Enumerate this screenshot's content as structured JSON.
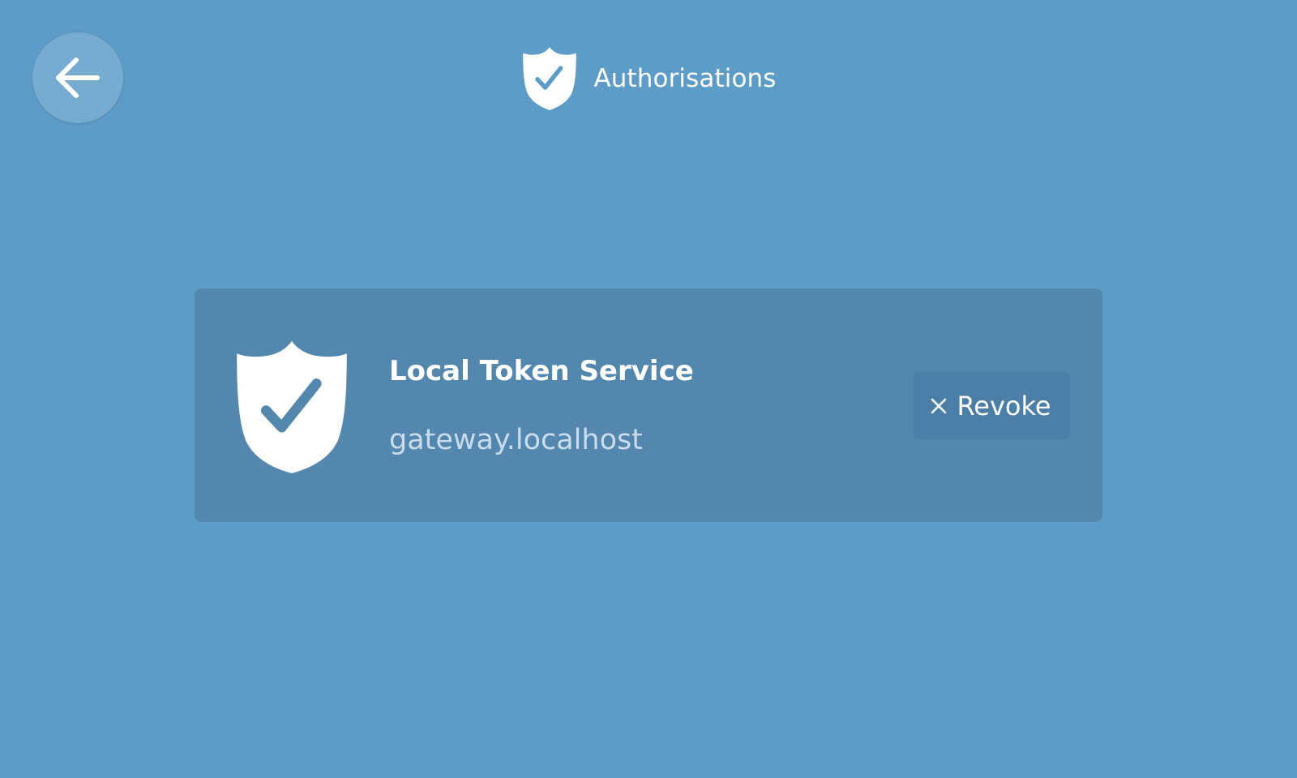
{
  "header": {
    "title": "Authorisations",
    "icon": "shield-check-icon"
  },
  "back_button": {
    "icon": "back-arrow-icon"
  },
  "authorisations": [
    {
      "name": "Local Token Service",
      "host": "gateway.localhost",
      "icon": "shield-check-icon",
      "action": {
        "label": "Revoke",
        "icon": "close-icon"
      }
    }
  ],
  "colors": {
    "background": "#5d9cc7",
    "card": "#5387ae",
    "button": "#4b7fa7",
    "text": "#ffffff",
    "muted_text": "#c9dced",
    "check": "#5d9cc7"
  }
}
